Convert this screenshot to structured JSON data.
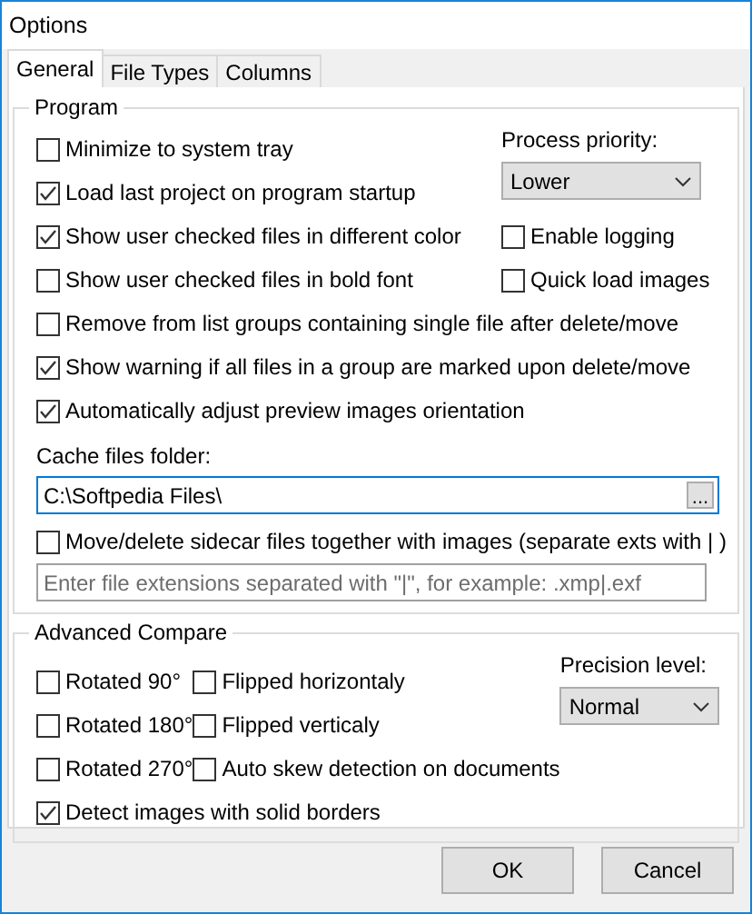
{
  "window": {
    "title": "Options"
  },
  "tabs": [
    {
      "label": "General",
      "selected": true
    },
    {
      "label": "File Types",
      "selected": false
    },
    {
      "label": "Columns",
      "selected": false
    }
  ],
  "program": {
    "title": "Program",
    "left_options": [
      {
        "label": "Minimize to system tray",
        "checked": false
      },
      {
        "label": "Load last project on program startup",
        "checked": true
      },
      {
        "label": "Show user checked files in different color",
        "checked": true
      },
      {
        "label": "Show user checked files in bold font",
        "checked": false
      }
    ],
    "process_priority": {
      "label": "Process priority:",
      "value": "Lower"
    },
    "right_options": [
      {
        "label": "Enable logging",
        "checked": false
      },
      {
        "label": "Quick load images",
        "checked": false
      }
    ],
    "more_options": [
      {
        "label": "Remove from list groups containing single file after delete/move",
        "checked": false
      },
      {
        "label": "Show warning if all files in a group are marked upon delete/move",
        "checked": true
      },
      {
        "label": "Automatically adjust preview images orientation",
        "checked": true
      }
    ],
    "cache_folder": {
      "label": "Cache files folder:",
      "value": "C:\\Softpedia Files\\",
      "browse": "..."
    },
    "sidecar": {
      "label": "Move/delete sidecar files together with images (separate exts with | )",
      "checked": false
    },
    "extensions": {
      "placeholder": "Enter file extensions separated with \"|\", for example: .xmp|.exf"
    }
  },
  "advanced": {
    "title": "Advanced Compare",
    "rotation_options": [
      {
        "label": "Rotated 90°",
        "checked": false
      },
      {
        "label": "Rotated 180°",
        "checked": false
      },
      {
        "label": "Rotated 270°",
        "checked": false
      }
    ],
    "flip_options": [
      {
        "label": "Flipped horizontaly",
        "checked": false
      },
      {
        "label": "Flipped verticaly",
        "checked": false
      },
      {
        "label": "Auto skew detection on documents",
        "checked": false
      }
    ],
    "precision": {
      "label": "Precision level:",
      "value": "Normal"
    },
    "bottom_option": {
      "label": "Detect images with solid borders",
      "checked": true
    }
  },
  "buttons": [
    "OK",
    "Cancel"
  ]
}
